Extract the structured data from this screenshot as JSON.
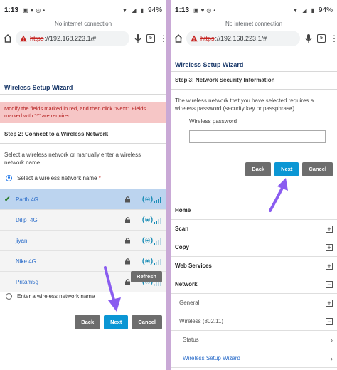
{
  "common": {
    "time": "1:13",
    "battery": "94%",
    "no_internet": "No internet connection",
    "url_scheme": "https",
    "url_rest": "://192.168.223.1/#",
    "tab_count": "5",
    "wizard_title": "Wireless Setup Wizard"
  },
  "left": {
    "error_text": "Modify the fields marked in red, and then click \"Next\". Fields marked with \"*\" are required.",
    "step_title": "Step 2: Connect to a Wireless Network",
    "description": "Select a wireless network or manually enter a wireless network name.",
    "select_label": "Select a wireless network name",
    "required_mark": "*",
    "networks": [
      {
        "ssid": "Parth 4G",
        "selected": true
      },
      {
        "ssid": "Dilip_4G",
        "selected": false
      },
      {
        "ssid": "jiyan",
        "selected": false
      },
      {
        "ssid": "Nike 4G",
        "selected": false
      },
      {
        "ssid": "Pritam5g",
        "selected": false
      }
    ],
    "refresh_label": "Refresh",
    "manual_label": "Enter a wireless network name",
    "back_label": "Back",
    "next_label": "Next",
    "cancel_label": "Cancel"
  },
  "right": {
    "step_title": "Step 3: Network Security Information",
    "description": "The wireless network that you have selected requires a wireless password (security key or passphrase).",
    "password_label": "Wireless password",
    "password_value": "",
    "back_label": "Back",
    "next_label": "Next",
    "cancel_label": "Cancel",
    "nav": {
      "home": "Home",
      "scan": "Scan",
      "copy": "Copy",
      "web_services": "Web Services",
      "network": "Network",
      "general": "General",
      "wireless": "Wireless (802.11)",
      "status": "Status",
      "wizard": "Wireless Setup Wizard"
    }
  },
  "colors": {
    "accent_blue": "#0b96d4",
    "error_bg": "#f6c6c6",
    "selected_row": "#bcd4ef",
    "arrow": "#8a5cf0"
  }
}
